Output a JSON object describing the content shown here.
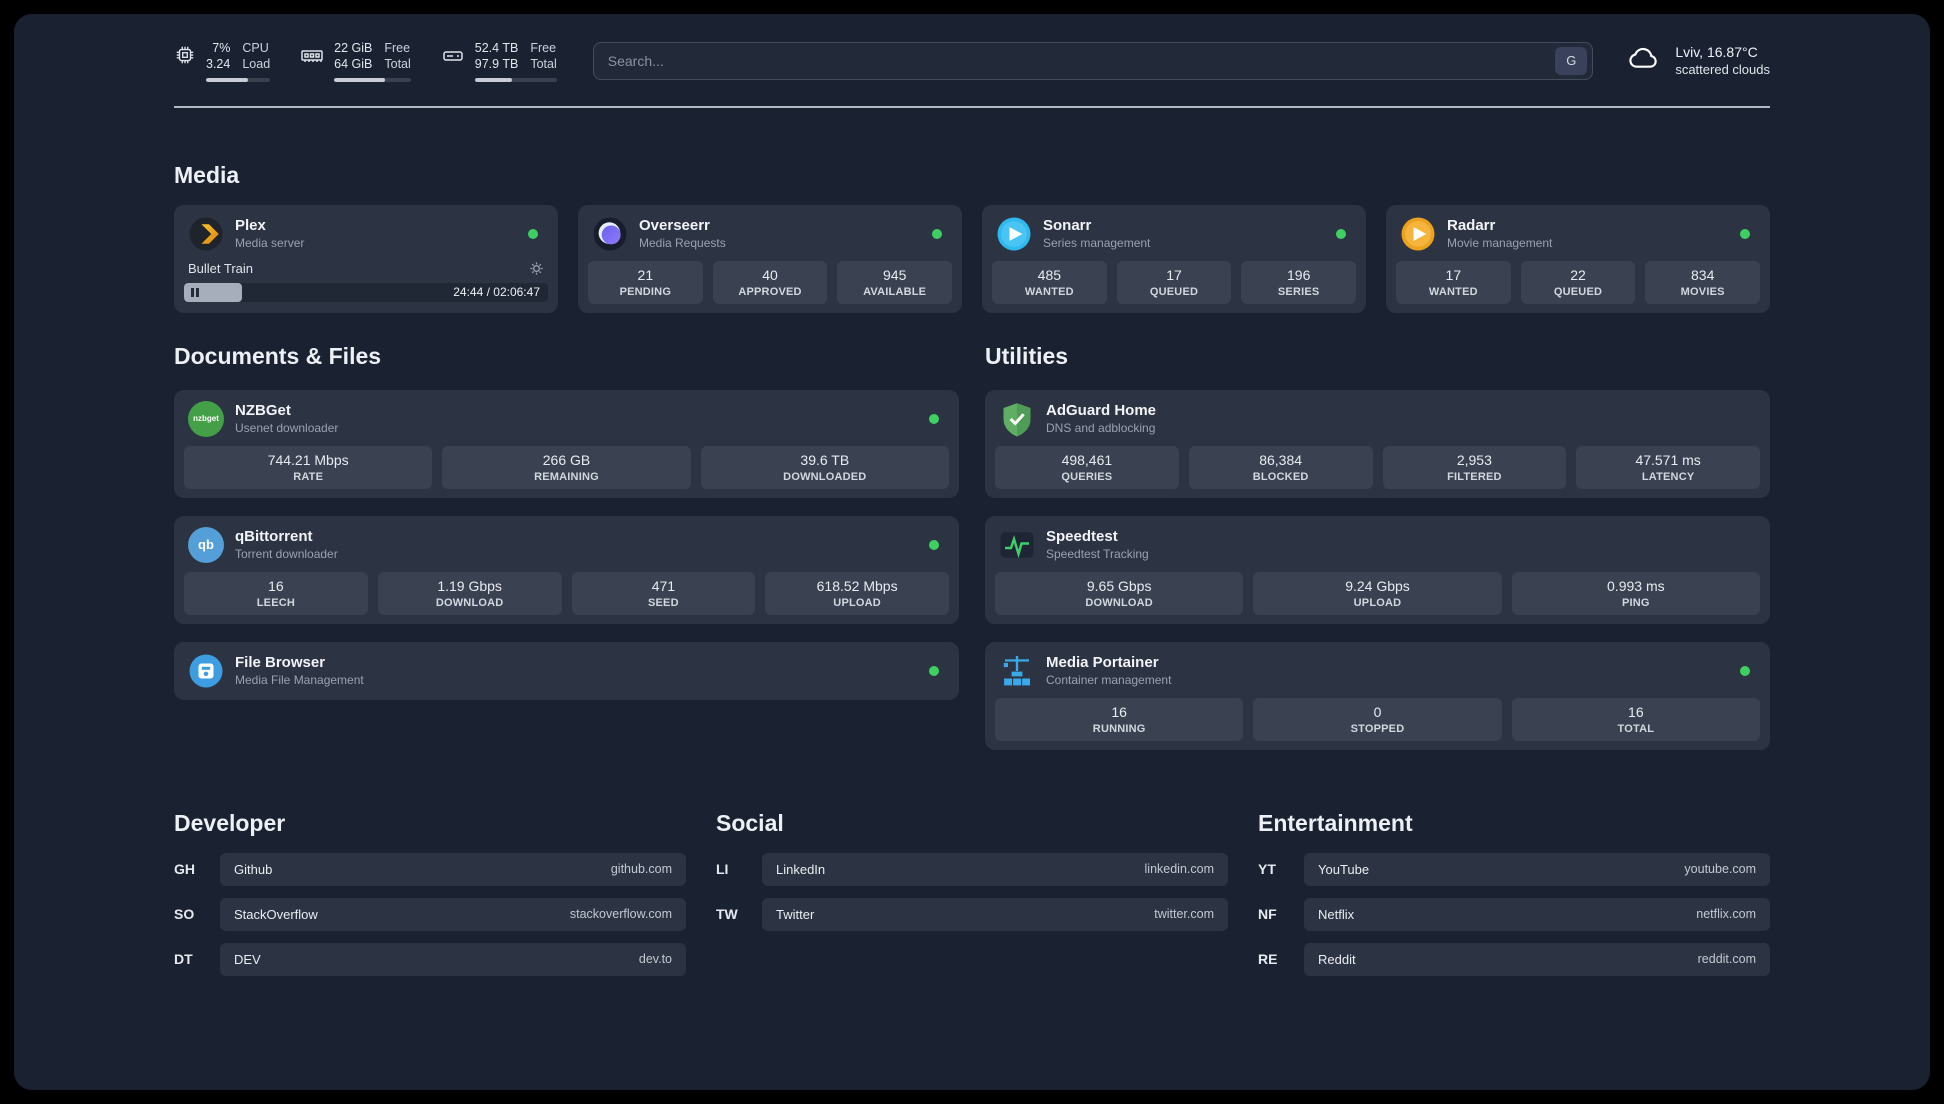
{
  "colors": {
    "status_green": "#3ecf63",
    "accent_blue": "#3aa9e9",
    "plex_orange": "#e8a020"
  },
  "topbar": {
    "cpu": {
      "percent": "7%",
      "load": "3.24",
      "name_line1": "CPU",
      "name_line2": "Load",
      "bar_percent": 65
    },
    "memory": {
      "free_value": "22 GiB",
      "total_value": "64 GiB",
      "free_label": "Free",
      "total_label": "Total",
      "bar_percent": 66
    },
    "disk": {
      "free_value": "52.4 TB",
      "total_value": "97.9 TB",
      "free_label": "Free",
      "total_label": "Total",
      "bar_percent": 46
    },
    "search": {
      "placeholder": "Search...",
      "button_label": "G"
    },
    "weather": {
      "location": "Lviv, 16.87°C",
      "condition": "scattered clouds"
    }
  },
  "media": {
    "heading": "Media",
    "plex": {
      "title": "Plex",
      "subtitle": "Media server",
      "now_playing": "Bullet Train",
      "time": "24:44 / 02:06:47",
      "progress_percent": 16
    },
    "overseerr": {
      "title": "Overseerr",
      "subtitle": "Media Requests",
      "stats": [
        {
          "value": "21",
          "label": "PENDING"
        },
        {
          "value": "40",
          "label": "APPROVED"
        },
        {
          "value": "945",
          "label": "AVAILABLE"
        }
      ]
    },
    "sonarr": {
      "title": "Sonarr",
      "subtitle": "Series management",
      "stats": [
        {
          "value": "485",
          "label": "WANTED"
        },
        {
          "value": "17",
          "label": "QUEUED"
        },
        {
          "value": "196",
          "label": "SERIES"
        }
      ]
    },
    "radarr": {
      "title": "Radarr",
      "subtitle": "Movie management",
      "stats": [
        {
          "value": "17",
          "label": "WANTED"
        },
        {
          "value": "22",
          "label": "QUEUED"
        },
        {
          "value": "834",
          "label": "MOVIES"
        }
      ]
    }
  },
  "documents": {
    "heading": "Documents & Files",
    "nzbget": {
      "title": "NZBGet",
      "subtitle": "Usenet downloader",
      "icon_text": "nzbget",
      "stats": [
        {
          "value": "744.21 Mbps",
          "label": "RATE"
        },
        {
          "value": "266 GB",
          "label": "REMAINING"
        },
        {
          "value": "39.6 TB",
          "label": "DOWNLOADED"
        }
      ]
    },
    "qbittorrent": {
      "title": "qBittorrent",
      "subtitle": "Torrent downloader",
      "icon_text": "qb",
      "stats": [
        {
          "value": "16",
          "label": "LEECH"
        },
        {
          "value": "1.19 Gbps",
          "label": "DOWNLOAD"
        },
        {
          "value": "471",
          "label": "SEED"
        },
        {
          "value": "618.52 Mbps",
          "label": "UPLOAD"
        }
      ]
    },
    "filebrowser": {
      "title": "File Browser",
      "subtitle": "Media File Management"
    }
  },
  "utilities": {
    "heading": "Utilities",
    "adguard": {
      "title": "AdGuard Home",
      "subtitle": "DNS and adblocking",
      "stats": [
        {
          "value": "498,461",
          "label": "QUERIES"
        },
        {
          "value": "86,384",
          "label": "BLOCKED"
        },
        {
          "value": "2,953",
          "label": "FILTERED"
        },
        {
          "value": "47.571 ms",
          "label": "LATENCY"
        }
      ]
    },
    "speedtest": {
      "title": "Speedtest",
      "subtitle": "Speedtest Tracking",
      "stats": [
        {
          "value": "9.65 Gbps",
          "label": "DOWNLOAD"
        },
        {
          "value": "9.24 Gbps",
          "label": "UPLOAD"
        },
        {
          "value": "0.993 ms",
          "label": "PING"
        }
      ]
    },
    "portainer": {
      "title": "Media Portainer",
      "subtitle": "Container management",
      "stats": [
        {
          "value": "16",
          "label": "RUNNING"
        },
        {
          "value": "0",
          "label": "STOPPED"
        },
        {
          "value": "16",
          "label": "TOTAL"
        }
      ]
    }
  },
  "bookmarks": {
    "developer": {
      "heading": "Developer",
      "items": [
        {
          "abbr": "GH",
          "name": "Github",
          "url": "github.com"
        },
        {
          "abbr": "SO",
          "name": "StackOverflow",
          "url": "stackoverflow.com"
        },
        {
          "abbr": "DT",
          "name": "DEV",
          "url": "dev.to"
        }
      ]
    },
    "social": {
      "heading": "Social",
      "items": [
        {
          "abbr": "LI",
          "name": "LinkedIn",
          "url": "linkedin.com"
        },
        {
          "abbr": "TW",
          "name": "Twitter",
          "url": "twitter.com"
        }
      ]
    },
    "entertainment": {
      "heading": "Entertainment",
      "items": [
        {
          "abbr": "YT",
          "name": "YouTube",
          "url": "youtube.com"
        },
        {
          "abbr": "NF",
          "name": "Netflix",
          "url": "netflix.com"
        },
        {
          "abbr": "RE",
          "name": "Reddit",
          "url": "reddit.com"
        }
      ]
    }
  }
}
